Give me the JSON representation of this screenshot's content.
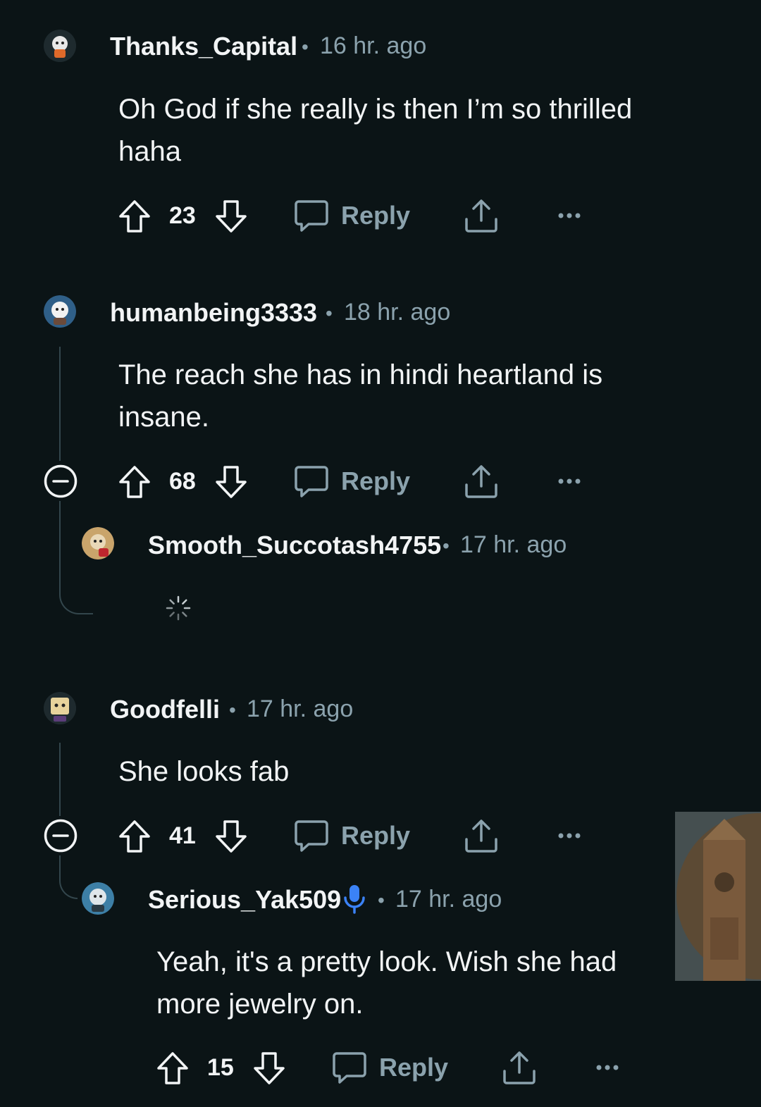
{
  "comments": [
    {
      "username": "Thanks_Capital",
      "time": "16 hr. ago",
      "text": "Oh God if she really is then I’m so thrilled haha",
      "votes": "23",
      "reply_label": "Reply"
    },
    {
      "username": "humanbeing3333",
      "time": "18 hr. ago",
      "text": "The reach she has in hindi heartland is insane.",
      "votes": "68",
      "reply_label": "Reply"
    },
    {
      "username": "Smooth_Succotash4755",
      "time": "17 hr. ago"
    },
    {
      "username": "Goodfelli",
      "time": "17 hr. ago",
      "text": "She looks fab",
      "votes": "41",
      "reply_label": "Reply"
    },
    {
      "username": "Serious_Yak509",
      "time": "17 hr. ago",
      "text": "Yeah, it's a pretty look. Wish she had more jewelry on.",
      "votes": "15",
      "reply_label": "Reply"
    }
  ],
  "separator": "•",
  "colors": {
    "background": "#0b1416",
    "muted": "#8ba2ad",
    "text": "#f2f4f5",
    "thread": "#33464c",
    "mic": "#3b82f6"
  },
  "icons": [
    "upvote-icon",
    "downvote-icon",
    "comment-icon",
    "share-icon",
    "more-icon",
    "collapse-icon",
    "loading-spinner-icon",
    "microphone-icon"
  ]
}
